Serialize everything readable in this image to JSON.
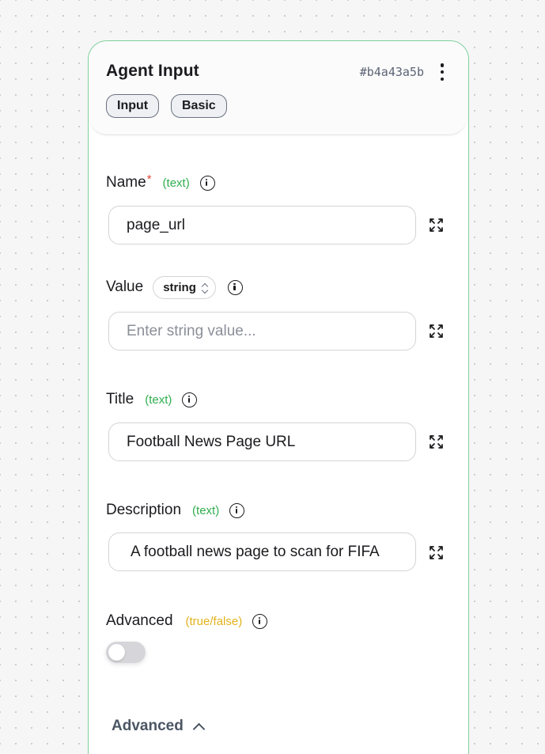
{
  "node": {
    "title": "Agent Input",
    "id": "#b4a43a5b",
    "badges": [
      "Input",
      "Basic"
    ]
  },
  "fields": {
    "name": {
      "label": "Name",
      "required_mark": "*",
      "type_hint": "(text)",
      "value": "page_url"
    },
    "value": {
      "label": "Value",
      "type_select": "string",
      "placeholder": "Enter string value..."
    },
    "title": {
      "label": "Title",
      "type_hint": "(text)",
      "value": "Football News Page URL"
    },
    "description": {
      "label": "Description",
      "type_hint": "(text)",
      "value": "A football news page to scan for FIFA"
    },
    "advanced": {
      "label": "Advanced",
      "type_hint": "(true/false)",
      "checked": false
    }
  },
  "advanced_section": {
    "label": "Advanced"
  },
  "colors": {
    "border_accent": "#7fd19a",
    "type_hint_green": "#2fae4e",
    "type_hint_yellow": "#e2b21a",
    "required": "#e0453a"
  },
  "icons": [
    "menu-dots-icon",
    "info-icon",
    "expand-icon",
    "chevron-up-icon",
    "select-chevron-icon"
  ]
}
